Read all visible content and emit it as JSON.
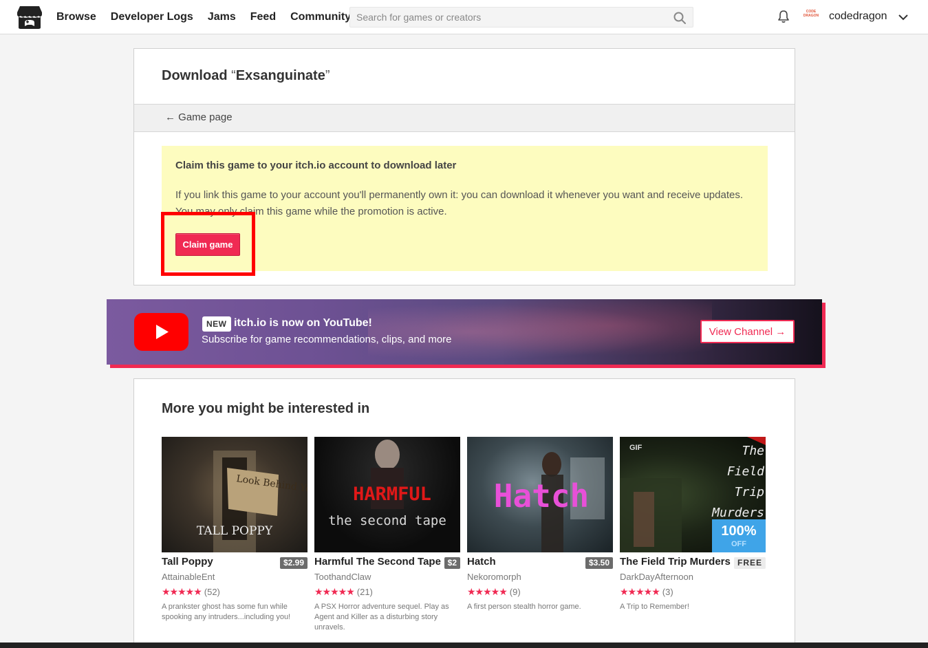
{
  "header": {
    "nav": [
      "Browse",
      "Developer Logs",
      "Jams",
      "Feed",
      "Community"
    ],
    "search_placeholder": "Search for games or creators",
    "avatar_text": "CODE DRAGON",
    "username": "codedragon"
  },
  "download": {
    "title_prefix": "Download",
    "quote_open": "“",
    "game_name": "Exsanguinate",
    "quote_close": "”",
    "back_link": "← Game page",
    "claim_title": "Claim this game to your itch.io account to download later",
    "claim_desc": "If you link this game to your account you'll permanently own it: you can download it whenever you want and receive updates. You may only claim this game while the promotion is active.",
    "claim_button": "Claim game"
  },
  "youtube": {
    "badge": "NEW",
    "title": "itch.io is now on YouTube!",
    "subtitle": "Subscribe for game recommendations, clips, and more",
    "button": "View Channel →"
  },
  "recommendations": {
    "heading": "More you might be interested in",
    "games": [
      {
        "title": "Tall Poppy",
        "price": "$2.99",
        "author": "AttainableEnt",
        "stars": "★★★★★",
        "count": "(52)",
        "desc": "A prankster ghost has some fun while spooking any intruders...including you!",
        "art_text": "TALL POPPY",
        "sign_text": "Look Behind You!"
      },
      {
        "title": "Harmful The Second Tape",
        "price": "$2",
        "author": "ToothandClaw",
        "stars": "★★★★★",
        "count": "(21)",
        "desc": "A PSX Horror adventure sequel. Play as Agent and Killer as a disturbing story unravels.",
        "art_text": "HARMFUL",
        "art_sub": "the second tape"
      },
      {
        "title": "Hatch",
        "price": "$3.50",
        "author": "Nekoromorph",
        "stars": "★★★★★",
        "count": "(9)",
        "desc": "A first person stealth horror game.",
        "art_text": "Hatch"
      },
      {
        "title": "The Field Trip Murders",
        "price": "FREE",
        "author": "DarkDayAfternoon",
        "stars": "★★★★★",
        "count": "(3)",
        "desc": "A Trip to Remember!",
        "art_text": "The Field Trip Murders",
        "gif_tag": "GIF",
        "sale_pct": "100%",
        "sale_off": "OFF"
      }
    ]
  },
  "colors": {
    "accent": "#f02a53",
    "sale_blue": "#3fa4e8",
    "claim_bg": "#fdfcbf",
    "highlight": "#ff0000"
  }
}
